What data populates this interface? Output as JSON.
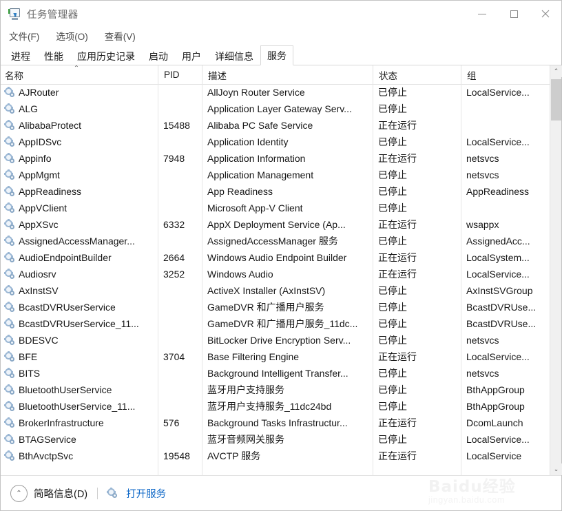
{
  "window": {
    "title": "任务管理器",
    "icon": "task-manager-icon",
    "controls": {
      "minimize": "—",
      "maximize": "□",
      "close": "✕"
    }
  },
  "menu": {
    "items": [
      "文件(F)",
      "选项(O)",
      "查看(V)"
    ]
  },
  "tabs": [
    {
      "label": "进程",
      "active": false
    },
    {
      "label": "性能",
      "active": false
    },
    {
      "label": "应用历史记录",
      "active": false
    },
    {
      "label": "启动",
      "active": false
    },
    {
      "label": "用户",
      "active": false
    },
    {
      "label": "详细信息",
      "active": false
    },
    {
      "label": "服务",
      "active": true
    }
  ],
  "table": {
    "columns": [
      "名称",
      "PID",
      "描述",
      "状态",
      "组"
    ],
    "sort_indicator": "⌃",
    "rows": [
      {
        "name": "AJRouter",
        "pid": "",
        "desc": "AllJoyn Router Service",
        "status": "已停止",
        "group": "LocalService..."
      },
      {
        "name": "ALG",
        "pid": "",
        "desc": "Application Layer Gateway Serv...",
        "status": "已停止",
        "group": ""
      },
      {
        "name": "AlibabaProtect",
        "pid": "15488",
        "desc": "Alibaba PC Safe Service",
        "status": "正在运行",
        "group": ""
      },
      {
        "name": "AppIDSvc",
        "pid": "",
        "desc": "Application Identity",
        "status": "已停止",
        "group": "LocalService..."
      },
      {
        "name": "Appinfo",
        "pid": "7948",
        "desc": "Application Information",
        "status": "正在运行",
        "group": "netsvcs"
      },
      {
        "name": "AppMgmt",
        "pid": "",
        "desc": "Application Management",
        "status": "已停止",
        "group": "netsvcs"
      },
      {
        "name": "AppReadiness",
        "pid": "",
        "desc": "App Readiness",
        "status": "已停止",
        "group": "AppReadiness"
      },
      {
        "name": "AppVClient",
        "pid": "",
        "desc": "Microsoft App-V Client",
        "status": "已停止",
        "group": ""
      },
      {
        "name": "AppXSvc",
        "pid": "6332",
        "desc": "AppX Deployment Service (Ap...",
        "status": "正在运行",
        "group": "wsappx"
      },
      {
        "name": "AssignedAccessManager...",
        "pid": "",
        "desc": "AssignedAccessManager 服务",
        "status": "已停止",
        "group": "AssignedAcc..."
      },
      {
        "name": "AudioEndpointBuilder",
        "pid": "2664",
        "desc": "Windows Audio Endpoint Builder",
        "status": "正在运行",
        "group": "LocalSystem..."
      },
      {
        "name": "Audiosrv",
        "pid": "3252",
        "desc": "Windows Audio",
        "status": "正在运行",
        "group": "LocalService..."
      },
      {
        "name": "AxInstSV",
        "pid": "",
        "desc": "ActiveX Installer (AxInstSV)",
        "status": "已停止",
        "group": "AxInstSVGroup"
      },
      {
        "name": "BcastDVRUserService",
        "pid": "",
        "desc": "GameDVR 和广播用户服务",
        "status": "已停止",
        "group": "BcastDVRUse..."
      },
      {
        "name": "BcastDVRUserService_11...",
        "pid": "",
        "desc": "GameDVR 和广播用户服务_11dc...",
        "status": "已停止",
        "group": "BcastDVRUse..."
      },
      {
        "name": "BDESVC",
        "pid": "",
        "desc": "BitLocker Drive Encryption Serv...",
        "status": "已停止",
        "group": "netsvcs"
      },
      {
        "name": "BFE",
        "pid": "3704",
        "desc": "Base Filtering Engine",
        "status": "正在运行",
        "group": "LocalService..."
      },
      {
        "name": "BITS",
        "pid": "",
        "desc": "Background Intelligent Transfer...",
        "status": "已停止",
        "group": "netsvcs"
      },
      {
        "name": "BluetoothUserService",
        "pid": "",
        "desc": "蓝牙用户支持服务",
        "status": "已停止",
        "group": "BthAppGroup"
      },
      {
        "name": "BluetoothUserService_11...",
        "pid": "",
        "desc": "蓝牙用户支持服务_11dc24bd",
        "status": "已停止",
        "group": "BthAppGroup"
      },
      {
        "name": "BrokerInfrastructure",
        "pid": "576",
        "desc": "Background Tasks Infrastructur...",
        "status": "正在运行",
        "group": "DcomLaunch"
      },
      {
        "name": "BTAGService",
        "pid": "",
        "desc": "蓝牙音频网关服务",
        "status": "已停止",
        "group": "LocalService..."
      },
      {
        "name": "BthAvctpSvc",
        "pid": "19548",
        "desc": "AVCTP 服务",
        "status": "正在运行",
        "group": "LocalService"
      }
    ]
  },
  "scrollbar": {
    "up_arrow": "⌃",
    "down_arrow": "⌄"
  },
  "statusbar": {
    "collapse_icon": "⌃",
    "fewer_details": "简略信息(D)",
    "open_services_icon": "gear-icon",
    "open_services": "打开服务"
  },
  "watermark": {
    "top": "Baidu经验",
    "bottom": "jingyan.baidu.com"
  },
  "colors": {
    "link": "#1069c8",
    "accent": "#2f80c4",
    "icon": "#9bb7d4"
  }
}
